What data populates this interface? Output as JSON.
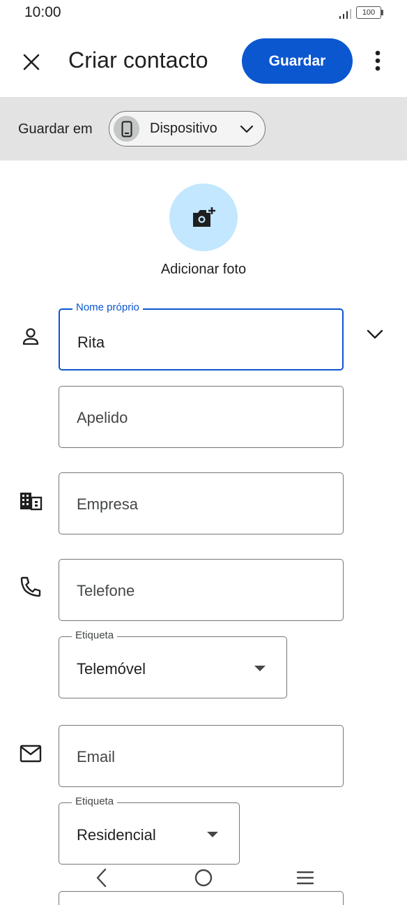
{
  "status_bar": {
    "time": "10:00",
    "battery": "100"
  },
  "appbar": {
    "title": "Criar contacto",
    "save_label": "Guardar",
    "close_icon": "close-icon",
    "more_icon": "more-vert-icon"
  },
  "save_location": {
    "label": "Guardar em",
    "account": "Dispositivo",
    "account_icon": "phone-device-icon"
  },
  "photo": {
    "label": "Adicionar foto",
    "icon": "add-photo-icon"
  },
  "fields": {
    "first_name": {
      "label": "Nome próprio",
      "value": "Rita"
    },
    "last_name": {
      "placeholder": "Apelido"
    },
    "company": {
      "placeholder": "Empresa"
    },
    "phone": {
      "placeholder": "Telefone"
    },
    "phone_label": {
      "label": "Etiqueta",
      "value": "Telemóvel"
    },
    "email": {
      "placeholder": "Email"
    },
    "email_label": {
      "label": "Etiqueta",
      "value": "Residencial"
    }
  },
  "colors": {
    "accent": "#0b57d0",
    "strip_bg": "#e2e3e2",
    "photo_bg": "#c2e7ff"
  },
  "navbar": {
    "back_icon": "back-icon",
    "home_icon": "home-icon",
    "recents_icon": "menu-icon"
  }
}
